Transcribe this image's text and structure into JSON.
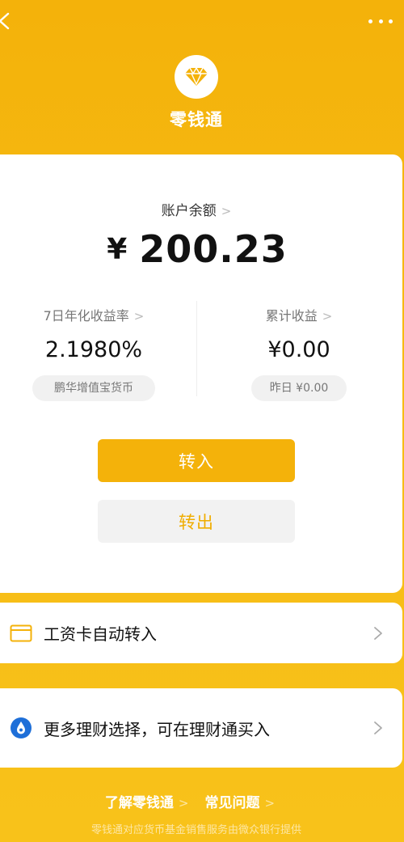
{
  "header": {
    "back_icon": "chevron-left-icon",
    "more_icon": "more-dots-icon",
    "logo_icon": "diamond-icon",
    "title": "零钱通"
  },
  "balance": {
    "label": "账户余额",
    "currency": "¥",
    "amount": "200.23"
  },
  "stats": {
    "yield": {
      "label": "7日年化收益率",
      "value": "2.1980%",
      "pill": "鹏华增值宝货币"
    },
    "earnings": {
      "label": "累计收益",
      "value": "¥0.00",
      "pill": "昨日 ¥0.00"
    }
  },
  "actions": {
    "transfer_in": "转入",
    "transfer_out": "转出"
  },
  "rows": {
    "salary": {
      "label": "工资卡自动转入",
      "icon": "card-icon"
    },
    "wealth": {
      "label": "更多理财选择，可在理财通买入",
      "icon": "wealth-drop-icon"
    }
  },
  "footer": {
    "link_about": "了解零钱通",
    "link_faq": "常见问题",
    "note": "零钱通对应货币基金销售服务由微众银行提供"
  },
  "colors": {
    "accent": "#f4b20a",
    "out_text": "#f0ad00",
    "icon_blue": "#1e6fd8"
  }
}
